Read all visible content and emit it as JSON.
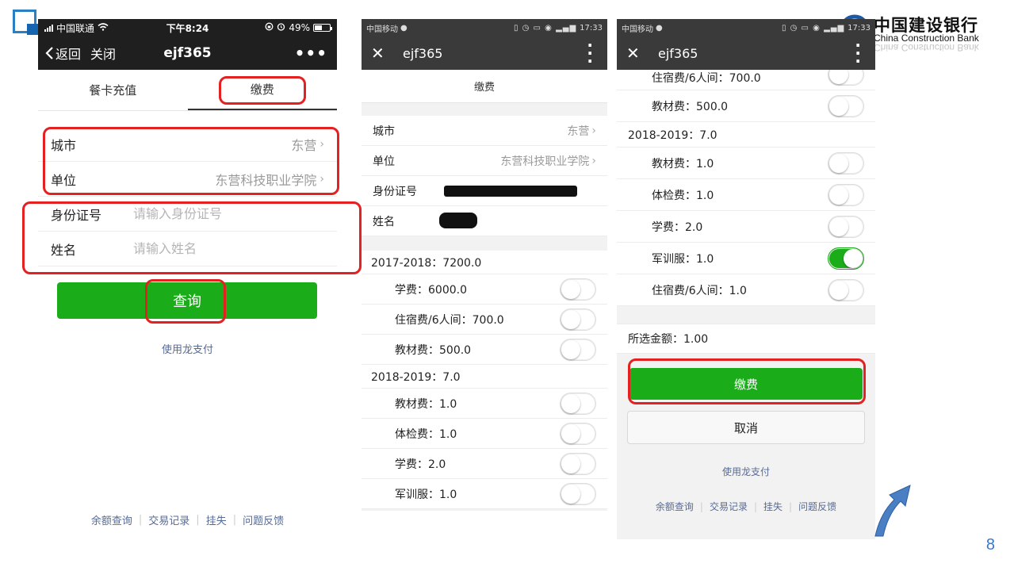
{
  "page_number": "8",
  "logo": {
    "cn": "中国建设银行",
    "en": "China Construction Bank"
  },
  "colors": {
    "primary_green": "#1aad19",
    "highlight_red": "#e52020",
    "link_blue": "#576b95",
    "dark_bar": "#1f1f1f"
  },
  "phone1": {
    "status": {
      "carrier": "中国联通",
      "time": "下午8:24",
      "battery": "49%",
      "battery_level": 0.49
    },
    "nav": {
      "back": "返回",
      "close": "关闭",
      "title": "ejf365",
      "more": "•••"
    },
    "tabs": [
      {
        "label": "餐卡充值"
      },
      {
        "label": "缴费"
      }
    ],
    "city": {
      "label": "城市",
      "value": "东营"
    },
    "unit": {
      "label": "单位",
      "value": "东营科技职业学院"
    },
    "id_field": {
      "label": "身份证号",
      "placeholder": "请输入身份证号"
    },
    "name_field": {
      "label": "姓名",
      "placeholder": "请输入姓名"
    },
    "query_button": "查询",
    "use_link": "使用龙支付",
    "footer": [
      "余额查询",
      "交易记录",
      "挂失",
      "问题反馈"
    ]
  },
  "phone2": {
    "status": {
      "carrier": "中国移动",
      "time": "17:33"
    },
    "nav": {
      "title": "ejf365"
    },
    "sub_title": "缴费",
    "city": {
      "label": "城市",
      "value": "东营"
    },
    "unit": {
      "label": "单位",
      "value": "东营科技职业学院"
    },
    "id_label": "身份证号",
    "name_label": "姓名",
    "year1": "2017-2018：7200.0",
    "year1_fees": [
      "学费：6000.0",
      "住宿费/6人间：700.0",
      "教材费：500.0"
    ],
    "year2": "2018-2019：7.0",
    "year2_fees": [
      "教材费：1.0",
      "体检费：1.0",
      "学费：2.0",
      "军训服：1.0"
    ]
  },
  "phone3": {
    "status": {
      "carrier": "中国移动",
      "time": "17:33"
    },
    "nav": {
      "title": "ejf365"
    },
    "top_fees": [
      "住宿费/6人间：700.0",
      "教材费：500.0"
    ],
    "year2": "2018-2019：7.0",
    "year2_fees": [
      {
        "label": "教材费：1.0",
        "on": false
      },
      {
        "label": "体检费：1.0",
        "on": false
      },
      {
        "label": "学费：2.0",
        "on": false
      },
      {
        "label": "军训服：1.0",
        "on": true
      },
      {
        "label": "住宿费/6人间：1.0",
        "on": false
      }
    ],
    "amount": "所选金额：1.00",
    "pay_button": "缴费",
    "cancel_button": "取消",
    "use_link": "使用龙支付",
    "footer": [
      "余额查询",
      "交易记录",
      "挂失",
      "问题反馈"
    ]
  }
}
